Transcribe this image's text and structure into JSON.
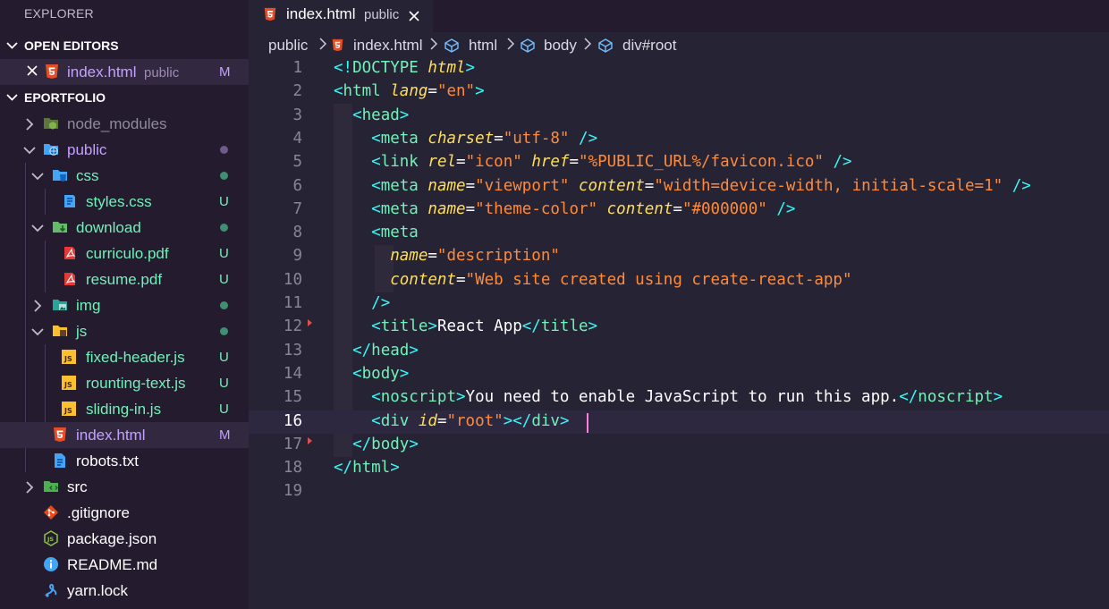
{
  "sidebar": {
    "title": "EXPLORER",
    "open_editors": {
      "label": "OPEN EDITORS",
      "items": [
        {
          "name": "index.html",
          "description": "public",
          "badge": "M"
        }
      ]
    },
    "project": {
      "label": "EPORTFOLIO",
      "tree": [
        {
          "label": "node_modules",
          "kind": "folder",
          "icon": "node-folder-icon"
        },
        {
          "label": "public",
          "kind": "folder",
          "icon": "public-folder-icon"
        },
        {
          "label": "css",
          "kind": "folder",
          "icon": "css-folder-icon"
        },
        {
          "label": "styles.css",
          "kind": "file",
          "icon": "css-file-icon",
          "badge": "U"
        },
        {
          "label": "download",
          "kind": "folder",
          "icon": "download-folder-icon"
        },
        {
          "label": "curriculo.pdf",
          "kind": "file",
          "icon": "pdf-icon",
          "badge": "U"
        },
        {
          "label": "resume.pdf",
          "kind": "file",
          "icon": "pdf-icon",
          "badge": "U"
        },
        {
          "label": "img",
          "kind": "folder",
          "icon": "image-folder-icon"
        },
        {
          "label": "js",
          "kind": "folder",
          "icon": "js-folder-icon"
        },
        {
          "label": "fixed-header.js",
          "kind": "file",
          "icon": "js-file-icon",
          "badge": "U"
        },
        {
          "label": "rounting-text.js",
          "kind": "file",
          "icon": "js-file-icon",
          "badge": "U"
        },
        {
          "label": "sliding-in.js",
          "kind": "file",
          "icon": "js-file-icon",
          "badge": "U"
        },
        {
          "label": "index.html",
          "kind": "file",
          "icon": "html-file-icon",
          "badge": "M"
        },
        {
          "label": "robots.txt",
          "kind": "file",
          "icon": "text-file-icon"
        },
        {
          "label": "src",
          "kind": "folder",
          "icon": "src-folder-icon"
        },
        {
          "label": ".gitignore",
          "kind": "file",
          "icon": "git-icon"
        },
        {
          "label": "package.json",
          "kind": "file",
          "icon": "nodejs-icon"
        },
        {
          "label": "README.md",
          "kind": "file",
          "icon": "info-icon"
        },
        {
          "label": "yarn.lock",
          "kind": "file",
          "icon": "yarn-icon"
        }
      ]
    }
  },
  "editor": {
    "tab": {
      "label": "index.html",
      "description": "public"
    },
    "breadcrumbs": [
      "public",
      "index.html",
      "html",
      "body",
      "div#root"
    ],
    "current_line": 16,
    "lines": [
      {
        "n": "1",
        "tokens": [
          [
            "brk",
            "<!"
          ],
          [
            "tag",
            "DOCTYPE"
          ],
          [
            "txt",
            " "
          ],
          [
            "attr",
            "html"
          ],
          [
            "brk",
            ">"
          ]
        ]
      },
      {
        "n": "2",
        "tokens": [
          [
            "brk",
            "<"
          ],
          [
            "tag",
            "html"
          ],
          [
            "txt",
            " "
          ],
          [
            "attr",
            "lang"
          ],
          [
            "eq",
            "="
          ],
          [
            "str",
            "\"en\""
          ],
          [
            "brk",
            ">"
          ]
        ]
      },
      {
        "n": "3",
        "tokens": [
          [
            "txt",
            "  "
          ],
          [
            "brk",
            "<"
          ],
          [
            "tag",
            "head"
          ],
          [
            "brk",
            ">"
          ]
        ]
      },
      {
        "n": "4",
        "tokens": [
          [
            "txt",
            "    "
          ],
          [
            "brk",
            "<"
          ],
          [
            "tag",
            "meta"
          ],
          [
            "txt",
            " "
          ],
          [
            "attr",
            "charset"
          ],
          [
            "eq",
            "="
          ],
          [
            "str",
            "\"utf-8\""
          ],
          [
            "txt",
            " "
          ],
          [
            "brk",
            "/>"
          ]
        ]
      },
      {
        "n": "5",
        "tokens": [
          [
            "txt",
            "    "
          ],
          [
            "brk",
            "<"
          ],
          [
            "tag",
            "link"
          ],
          [
            "txt",
            " "
          ],
          [
            "attr",
            "rel"
          ],
          [
            "eq",
            "="
          ],
          [
            "str",
            "\"icon\""
          ],
          [
            "txt",
            " "
          ],
          [
            "attr",
            "href"
          ],
          [
            "eq",
            "="
          ],
          [
            "str",
            "\"%PUBLIC_URL%/favicon.ico\""
          ],
          [
            "txt",
            " "
          ],
          [
            "brk",
            "/>"
          ]
        ]
      },
      {
        "n": "6",
        "tokens": [
          [
            "txt",
            "    "
          ],
          [
            "brk",
            "<"
          ],
          [
            "tag",
            "meta"
          ],
          [
            "txt",
            " "
          ],
          [
            "attr",
            "name"
          ],
          [
            "eq",
            "="
          ],
          [
            "str",
            "\"viewport\""
          ],
          [
            "txt",
            " "
          ],
          [
            "attr",
            "content"
          ],
          [
            "eq",
            "="
          ],
          [
            "str",
            "\"width=device-width, initial-scale=1\""
          ],
          [
            "txt",
            " "
          ],
          [
            "brk",
            "/>"
          ]
        ]
      },
      {
        "n": "7",
        "tokens": [
          [
            "txt",
            "    "
          ],
          [
            "brk",
            "<"
          ],
          [
            "tag",
            "meta"
          ],
          [
            "txt",
            " "
          ],
          [
            "attr",
            "name"
          ],
          [
            "eq",
            "="
          ],
          [
            "str",
            "\"theme-color\""
          ],
          [
            "txt",
            " "
          ],
          [
            "attr",
            "content"
          ],
          [
            "eq",
            "="
          ],
          [
            "str",
            "\"#000000\""
          ],
          [
            "txt",
            " "
          ],
          [
            "brk",
            "/>"
          ]
        ]
      },
      {
        "n": "8",
        "tokens": [
          [
            "txt",
            "    "
          ],
          [
            "brk",
            "<"
          ],
          [
            "tag",
            "meta"
          ]
        ]
      },
      {
        "n": "9",
        "tokens": [
          [
            "txt",
            "      "
          ],
          [
            "attr",
            "name"
          ],
          [
            "eq",
            "="
          ],
          [
            "str",
            "\"description\""
          ]
        ]
      },
      {
        "n": "10",
        "tokens": [
          [
            "txt",
            "      "
          ],
          [
            "attr",
            "content"
          ],
          [
            "eq",
            "="
          ],
          [
            "str",
            "\"Web site created using create-react-app\""
          ]
        ]
      },
      {
        "n": "11",
        "tokens": [
          [
            "txt",
            "    "
          ],
          [
            "brk",
            "/>"
          ]
        ]
      },
      {
        "n": "12",
        "tokens": [
          [
            "txt",
            "    "
          ],
          [
            "brk",
            "<"
          ],
          [
            "tag",
            "title"
          ],
          [
            "brk",
            ">"
          ],
          [
            "txt",
            "React App"
          ],
          [
            "brk",
            "</"
          ],
          [
            "tag",
            "title"
          ],
          [
            "brk",
            ">"
          ]
        ]
      },
      {
        "n": "13",
        "tokens": [
          [
            "txt",
            "  "
          ],
          [
            "brk",
            "</"
          ],
          [
            "tag",
            "head"
          ],
          [
            "brk",
            ">"
          ]
        ]
      },
      {
        "n": "14",
        "tokens": [
          [
            "txt",
            "  "
          ],
          [
            "brk",
            "<"
          ],
          [
            "tag",
            "body"
          ],
          [
            "brk",
            ">"
          ]
        ]
      },
      {
        "n": "15",
        "tokens": [
          [
            "txt",
            "    "
          ],
          [
            "brk",
            "<"
          ],
          [
            "tag",
            "noscript"
          ],
          [
            "brk",
            ">"
          ],
          [
            "txt",
            "You need to enable JavaScript to run this app."
          ],
          [
            "brk",
            "</"
          ],
          [
            "tag",
            "noscript"
          ],
          [
            "brk",
            ">"
          ]
        ]
      },
      {
        "n": "16",
        "tokens": [
          [
            "txt",
            "    "
          ],
          [
            "brk",
            "<"
          ],
          [
            "tag",
            "div"
          ],
          [
            "txt",
            " "
          ],
          [
            "attr",
            "id"
          ],
          [
            "eq",
            "="
          ],
          [
            "str",
            "\"root\""
          ],
          [
            "brk",
            ">"
          ],
          [
            "brk",
            "</"
          ],
          [
            "tag",
            "div"
          ],
          [
            "brk",
            ">"
          ]
        ]
      },
      {
        "n": "17",
        "tokens": [
          [
            "txt",
            "  "
          ],
          [
            "brk",
            "</"
          ],
          [
            "tag",
            "body"
          ],
          [
            "brk",
            ">"
          ]
        ]
      },
      {
        "n": "18",
        "tokens": [
          [
            "brk",
            "</"
          ],
          [
            "tag",
            "html"
          ],
          [
            "brk",
            ">"
          ]
        ]
      },
      {
        "n": "19",
        "tokens": []
      }
    ]
  },
  "colors": {
    "sidebar_bg": "#241b2f",
    "editor_bg": "#262335",
    "untracked": "#72f1b8",
    "modified": "#c4a0ff",
    "tag": "#72f1b8",
    "bracket": "#36f9f6",
    "attribute": "#fede5d",
    "string": "#ff8b39"
  }
}
